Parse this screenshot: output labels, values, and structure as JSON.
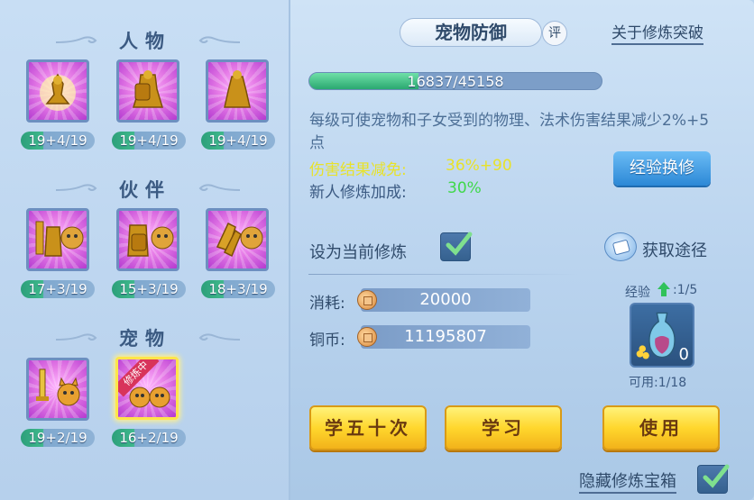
{
  "left": {
    "sections": [
      {
        "title": "人物"
      },
      {
        "title": "伙伴"
      },
      {
        "title": "宠物"
      }
    ],
    "character_levels": [
      "19+4/19",
      "19+4/19",
      "19+4/19"
    ],
    "partner_levels": [
      "17+3/19",
      "15+3/19",
      "18+3/19"
    ],
    "pet_levels": [
      "19+2/19",
      "16+2/19"
    ],
    "pet_badge": "修炼中"
  },
  "right": {
    "title": "宠物防御",
    "eval_label": "评",
    "about_link": "关于修炼突破",
    "xp": {
      "current": 16837,
      "max": 45158,
      "text": "16837/45158"
    },
    "description": "每级可使宠物和子女受到的物理、法术伤害结果减少2%+5点",
    "stat1_label": "伤害结果减免:",
    "stat1_value": "36%+90",
    "stat2_label": "新人修炼加成:",
    "stat2_value": "30%",
    "exchange_button": "经验换修",
    "set_current_label": "设为当前修炼",
    "set_current_checked": true,
    "obtain_label": "获取途径",
    "cost_label": "消耗:",
    "cost_value": "20000",
    "coins_label": "铜币:",
    "coins_value": "11195807",
    "exp_label": "经验",
    "exp_count": ":1/5",
    "item_count": "0",
    "available": "可用:1/18",
    "btn_learn50": "学五十次",
    "btn_learn": "学习",
    "btn_use": "使用",
    "hide_chest_label": "隐藏修炼宝箱",
    "hide_chest_checked": true
  },
  "colors": {
    "accent_blue": "#2c88d6",
    "gold_button": "#ffd72d",
    "stat_yellow": "#e8e22a",
    "stat_green": "#3fd84a",
    "xp_green": "#2aa870"
  }
}
